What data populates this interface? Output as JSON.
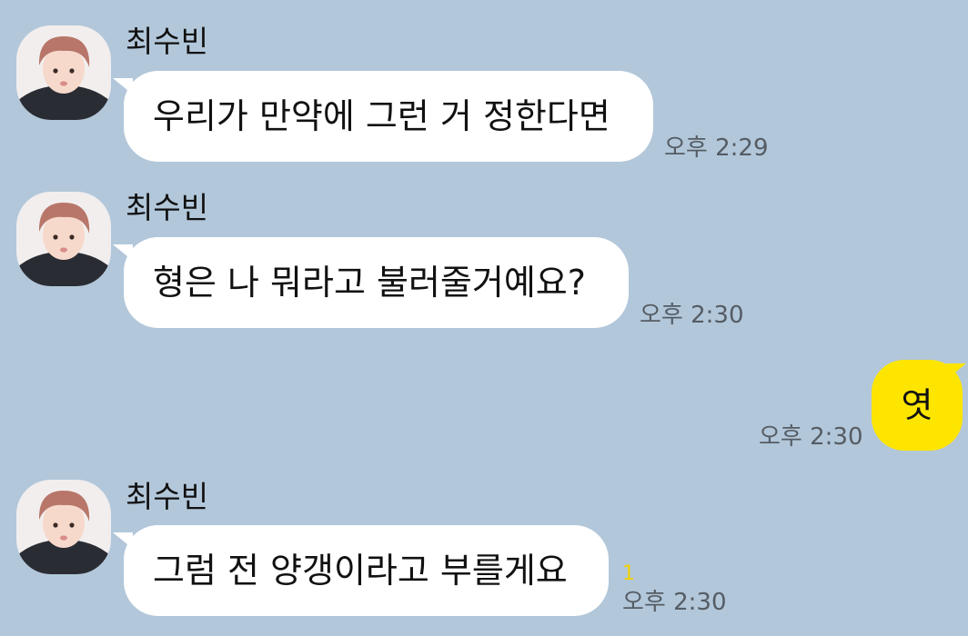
{
  "conversation": {
    "messages": [
      {
        "sender": "최수빈",
        "text": "우리가 만약에 그런 거 정한다면",
        "time": "오후 2:29"
      },
      {
        "sender": "최수빈",
        "text": "형은 나 뭐라고 불러줄거예요?",
        "time": "오후 2:30"
      },
      {
        "mine": true,
        "text": "엿",
        "time": "오후 2:30"
      },
      {
        "sender": "최수빈",
        "text": "그럼 전 양갱이라고 부를게요",
        "time": "오후 2:30",
        "unread": "1"
      }
    ]
  },
  "colors": {
    "background": "#b2c7da",
    "incoming_bubble": "#ffffff",
    "outgoing_bubble": "#fee500",
    "timestamp": "#555c64",
    "unread_count": "#f0d000"
  }
}
